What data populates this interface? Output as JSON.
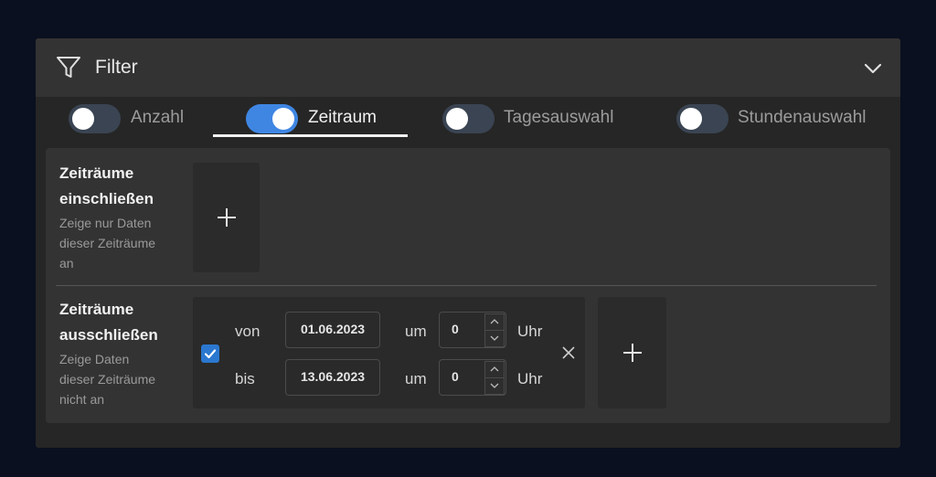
{
  "filter": {
    "title": "Filter",
    "icon": "filter-icon",
    "collapse_icon": "chevron-down-icon"
  },
  "tabs": [
    {
      "label": "Anzahl",
      "on": false,
      "active": false
    },
    {
      "label": "Zeitraum",
      "on": true,
      "active": true
    },
    {
      "label": "Tagesauswahl",
      "on": false,
      "active": false
    },
    {
      "label": "Stundenauswahl",
      "on": false,
      "active": false
    }
  ],
  "include": {
    "title_line1": "Zeiträume",
    "title_line2": "einschließen",
    "desc_line1": "Zeige nur Daten",
    "desc_line2": "dieser Zeiträume",
    "desc_line3": "an",
    "add_icon": "plus-icon"
  },
  "exclude": {
    "title_line1": "Zeiträume",
    "title_line2": "ausschließen",
    "desc_line1": "Zeige Daten",
    "desc_line2": "dieser Zeiträume",
    "desc_line3": "nicht an",
    "add_icon": "plus-icon",
    "range": {
      "checked": true,
      "from_label": "von",
      "to_label": "bis",
      "from_date": "01.06.2023",
      "to_date": "13.06.2023",
      "at_label": "um",
      "from_hour": "0",
      "to_hour": "0",
      "unit_label": "Uhr",
      "remove_icon": "close-icon"
    }
  },
  "colors": {
    "accent": "#3f86e3",
    "checkbox": "#2b78d0",
    "panel": "#262626",
    "header": "#333333",
    "background": "#0a1020"
  }
}
